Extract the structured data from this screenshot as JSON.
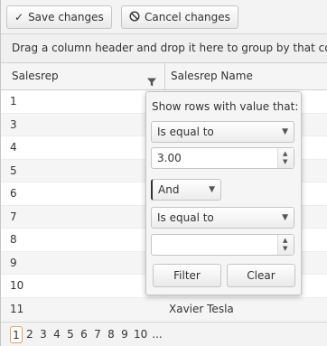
{
  "toolbar": {
    "save_label": "Save changes",
    "cancel_label": "Cancel changes"
  },
  "group_hint": "Drag a column header and drop it here to group by that column",
  "columns": [
    "Salesrep",
    "Salesrep Name"
  ],
  "rows": [
    {
      "id": "1",
      "name": ""
    },
    {
      "id": "3",
      "name": ""
    },
    {
      "id": "4",
      "name": ""
    },
    {
      "id": "5",
      "name": ""
    },
    {
      "id": "6",
      "name": ""
    },
    {
      "id": "7",
      "name": ""
    },
    {
      "id": "8",
      "name": ""
    },
    {
      "id": "9",
      "name": ""
    },
    {
      "id": "10",
      "name": ""
    },
    {
      "id": "11",
      "name": "Xavier Tesla"
    }
  ],
  "filter": {
    "title": "Show rows with value that:",
    "operator1": "Is equal to",
    "value1": "3.00",
    "logic": "And",
    "operator2": "Is equal to",
    "value2": "",
    "filter_label": "Filter",
    "clear_label": "Clear"
  },
  "pager": {
    "pages": [
      "1",
      "2",
      "3",
      "4",
      "5",
      "6",
      "7",
      "8",
      "9",
      "10",
      "..."
    ],
    "current": "1"
  }
}
